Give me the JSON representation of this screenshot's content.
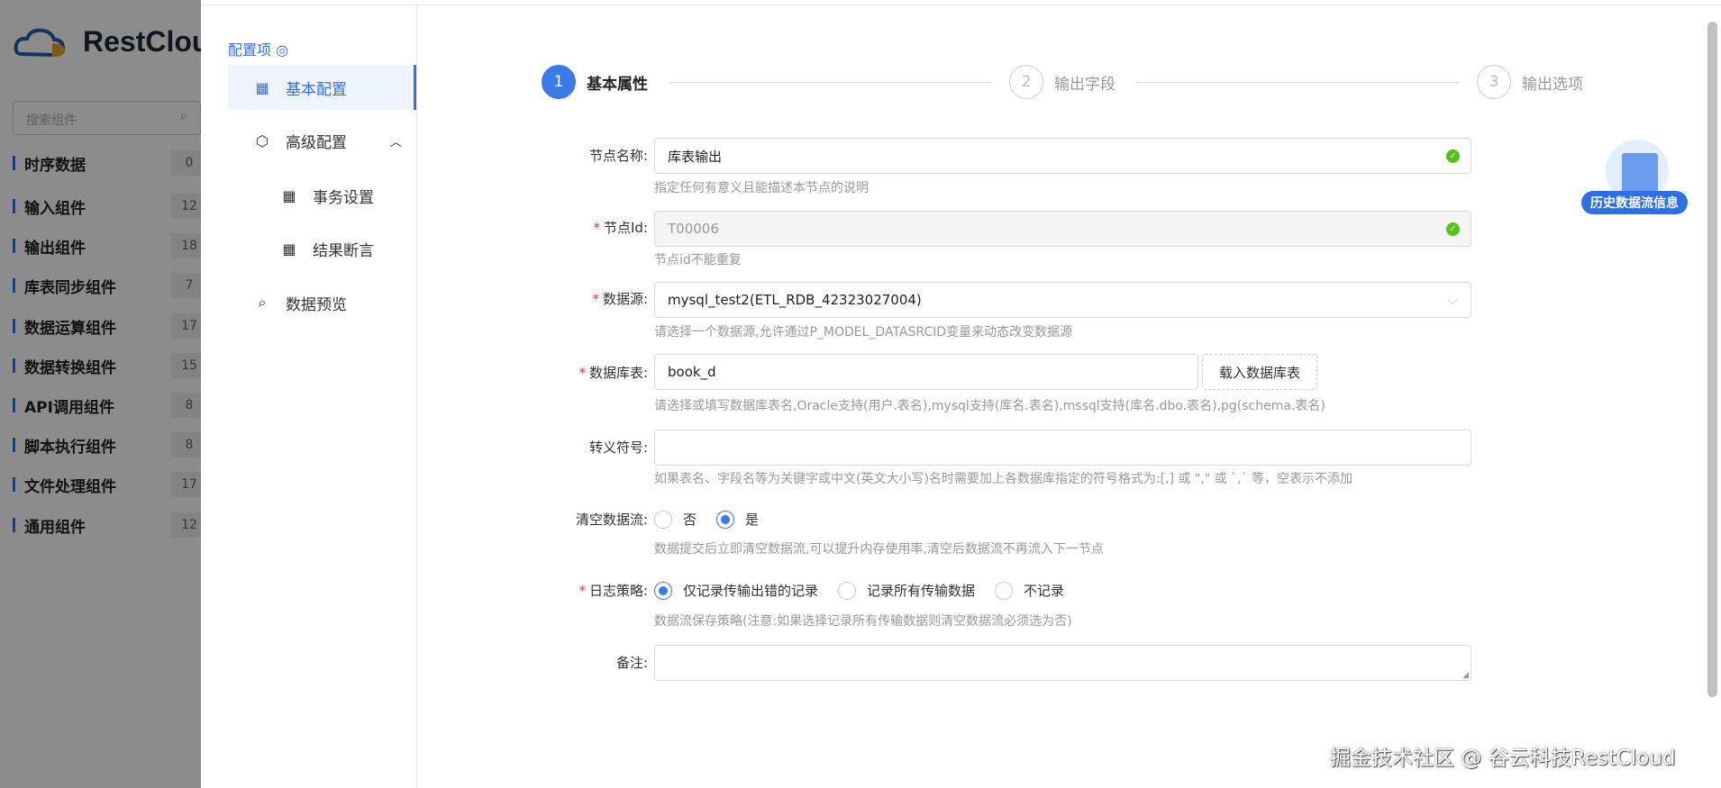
{
  "sidebar": {
    "logo": "RestCloud",
    "search_placeholder": "搜索组件",
    "categories": [
      {
        "label": "时序数据",
        "count": "0"
      },
      {
        "label": "输入组件",
        "count": "12"
      },
      {
        "label": "输出组件",
        "count": "18"
      },
      {
        "label": "库表同步组件",
        "count": "7"
      },
      {
        "label": "数据运算组件",
        "count": "17"
      },
      {
        "label": "数据转换组件",
        "count": "15"
      },
      {
        "label": "API调用组件",
        "count": "8"
      },
      {
        "label": "脚本执行组件",
        "count": "8"
      },
      {
        "label": "文件处理组件",
        "count": "17"
      },
      {
        "label": "通用组件",
        "count": "12"
      }
    ]
  },
  "nav": {
    "title": "配置项",
    "items": [
      {
        "label": "基本配置"
      },
      {
        "label": "高级配置"
      },
      {
        "label": "事务设置"
      },
      {
        "label": "结果断言"
      },
      {
        "label": "数据预览"
      }
    ]
  },
  "steps": [
    {
      "num": "1",
      "label": "基本属性"
    },
    {
      "num": "2",
      "label": "输出字段"
    },
    {
      "num": "3",
      "label": "输出选项"
    }
  ],
  "form": {
    "node_name": {
      "label": "节点名称:",
      "value": "库表输出",
      "hint": "指定任何有意义且能描述本节点的说明"
    },
    "node_id": {
      "label": "节点Id:",
      "value": "T00006",
      "hint": "节点id不能重复"
    },
    "datasource": {
      "label": "数据源:",
      "value": "mysql_test2(ETL_RDB_42323027004)",
      "hint": "请选择一个数据源,允许通过P_MODEL_DATASRCID变量来动态改变数据源"
    },
    "table": {
      "label": "数据库表:",
      "value": "book_d",
      "button": "载入数据库表",
      "hint": "请选择或填写数据库表名,Oracle支持(用户.表名),mysql支持(库名.表名),mssql支持(库名.dbo.表名),pg(schema.表名)"
    },
    "escape": {
      "label": "转义符号:",
      "value": "",
      "hint": "如果表名、字段名等为关键字或中文(英文大小写)名时需要加上各数据库指定的符号格式为:[,] 或 \",\" 或 `,` 等，空表示不添加"
    },
    "clear": {
      "label": "清空数据流:",
      "options": [
        "否",
        "是"
      ],
      "selected": "是",
      "hint": "数据提交后立即清空数据流,可以提升内存使用率,清空后数据流不再流入下一节点"
    },
    "log": {
      "label": "日志策略:",
      "options": [
        "仅记录传输出错的记录",
        "记录所有传输数据",
        "不记录"
      ],
      "selected": "仅记录传输出错的记录",
      "hint": "数据流保存策略(注意:如果选择记录所有传输数据则清空数据流必须选为否)"
    },
    "remark": {
      "label": "备注:",
      "value": ""
    },
    "required_mark": "*"
  },
  "history_label": "历史数据流信息",
  "watermark": "掘金技术社区 @ 谷云科技RestCloud",
  "colors": {
    "accent": "#3b7be8",
    "required": "#e0393e",
    "success": "#52c41a"
  }
}
